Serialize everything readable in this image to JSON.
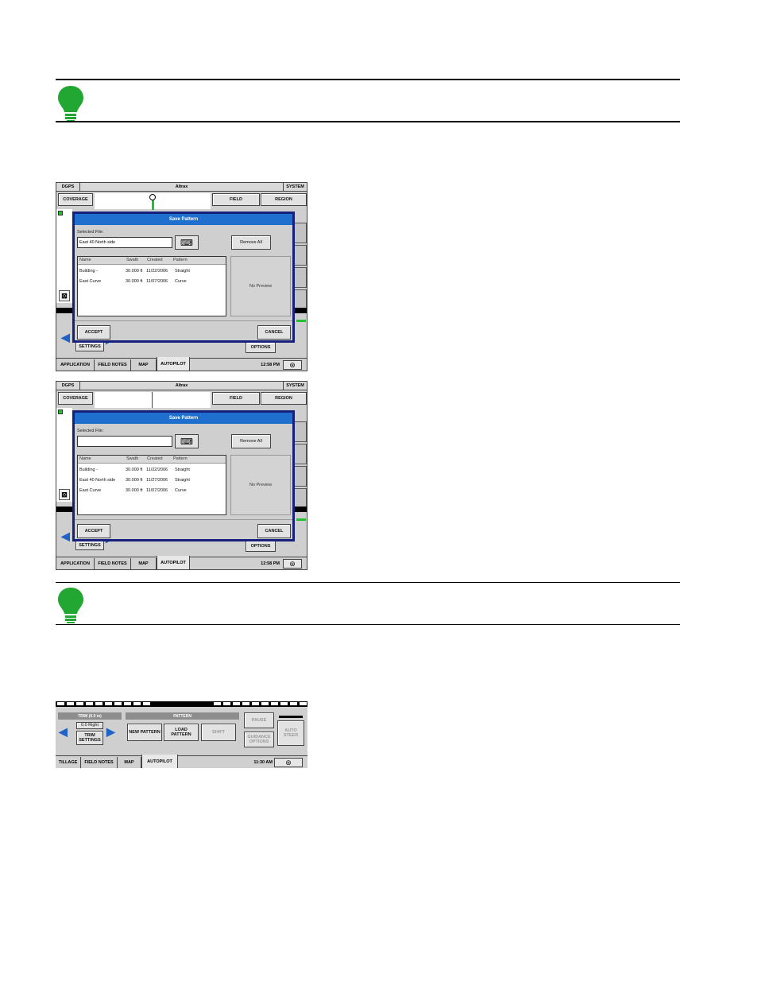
{
  "screens": {
    "screen1": {
      "top_bar": {
        "left": "DGPS",
        "center": "Altrax",
        "right": "SYSTEM"
      },
      "header_buttons": {
        "coverage": "COVERAGE",
        "field": "FIELD",
        "region": "REGION"
      },
      "dialog": {
        "title": "Save Pattern",
        "selected_file_label": "Selected File:",
        "selected_file_value": "East 40 North side",
        "remove_all": "Remove All",
        "columns": [
          "Name",
          "Swath",
          "Created",
          "Pattern"
        ],
        "rows": [
          {
            "name": "Building -",
            "swath": "30.000 ft",
            "created": "11/22/2006",
            "pattern": "Straight"
          },
          {
            "name": "East Curve",
            "swath": "30.000 ft",
            "created": "11/07/2006",
            "pattern": "Curve"
          }
        ],
        "preview": "No Preview",
        "accept": "ACCEPT",
        "cancel": "CANCEL"
      },
      "bottom": {
        "settings": "SETTINGS",
        "options": "OPTIONS"
      },
      "tabs": [
        "APPLICATION",
        "FIELD NOTES",
        "MAP",
        "AUTOPILOT"
      ],
      "clock": "12:58 PM"
    },
    "screen2": {
      "top_bar": {
        "left": "DGPS",
        "center": "Altrax",
        "right": "SYSTEM"
      },
      "header_buttons": {
        "coverage": "COVERAGE",
        "field": "FIELD",
        "region": "REGION"
      },
      "dialog": {
        "title": "Save Pattern",
        "selected_file_label": "Selected File:",
        "selected_file_value": "",
        "remove_all": "Remove All",
        "columns": [
          "Name",
          "Swath",
          "Created",
          "Pattern"
        ],
        "rows": [
          {
            "name": "Building -",
            "swath": "30.000 ft",
            "created": "11/22/2006",
            "pattern": "Straight"
          },
          {
            "name": "East 40 North side",
            "swath": "30.000 ft",
            "created": "11/27/2006",
            "pattern": "Straight"
          },
          {
            "name": "East Curve",
            "swath": "30.000 ft",
            "created": "11/07/2006",
            "pattern": "Curve"
          }
        ],
        "preview": "No Preview",
        "accept": "ACCEPT",
        "cancel": "CANCEL"
      },
      "bottom": {
        "settings": "SETTINGS",
        "options": "OPTIONS"
      },
      "tabs": [
        "APPLICATION",
        "FIELD NOTES",
        "MAP",
        "AUTOPILOT"
      ],
      "clock": "12:58 PM"
    },
    "screen3": {
      "trim_header": "TRIM (0.0 in)",
      "trim_value": "0.0 Right",
      "trim_settings": "TRIM SETTINGS",
      "pattern_header": "PATTERN",
      "new_pattern": "NEW PATTERN",
      "load_pattern": "LOAD PATTERN",
      "shift": "SHIFT",
      "pause": "PAUSE",
      "guidance_options": "GUIDANCE OPTIONS",
      "auto_steer": "AUTO STEER",
      "tabs": [
        "TILLAGE",
        "FIELD NOTES",
        "MAP",
        "AUTOPILOT"
      ],
      "clock": "11:30 AM"
    }
  },
  "colors": {
    "bulb": "#22a832",
    "dialog_title": "#1f6fcf",
    "dialog_border": "#17207a",
    "arrow": "#1f63c9"
  }
}
